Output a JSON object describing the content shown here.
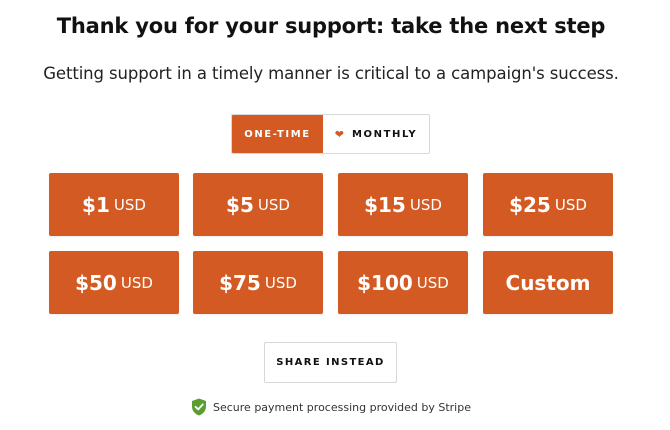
{
  "header": {
    "title": "Thank you for your support: take the next step",
    "subtitle": "Getting support in a timely manner is critical to a campaign's success."
  },
  "frequency_toggle": {
    "one_time_label": "ONE-TIME",
    "monthly_label": "MONTHLY",
    "selected": "one-time",
    "monthly_icon": "heart-icon"
  },
  "amounts": [
    {
      "value": "$1",
      "currency": "USD"
    },
    {
      "value": "$5",
      "currency": "USD"
    },
    {
      "value": "$15",
      "currency": "USD"
    },
    {
      "value": "$25",
      "currency": "USD"
    },
    {
      "value": "$50",
      "currency": "USD"
    },
    {
      "value": "$75",
      "currency": "USD"
    },
    {
      "value": "$100",
      "currency": "USD"
    }
  ],
  "custom_label": "Custom",
  "share_label": "SHARE INSTEAD",
  "secure_note": {
    "icon": "shield-check-icon",
    "text": "Secure payment processing provided by Stripe"
  },
  "colors": {
    "accent": "#d35a22",
    "shield": "#5a9e32"
  }
}
